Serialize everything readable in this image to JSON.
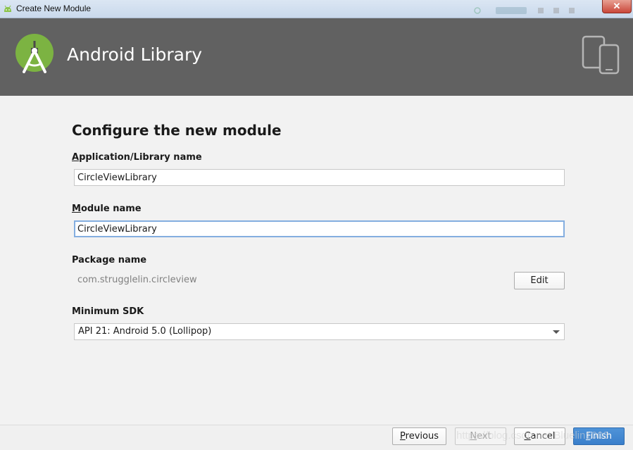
{
  "window": {
    "title": "Create New Module",
    "close_label": "✕"
  },
  "header": {
    "title": "Android Library"
  },
  "form": {
    "page_title": "Configure the new module",
    "app_name_label_mnemonic": "A",
    "app_name_label_rest": "pplication/Library name",
    "app_name_value": "CircleViewLibrary",
    "module_name_label_mnemonic": "M",
    "module_name_label_rest": "odule name",
    "module_name_value": "CircleViewLibrary",
    "package_label": "Package name",
    "package_value": "com.strugglelin.circleview",
    "edit_button": "Edit",
    "min_sdk_label": "Minimum SDK",
    "min_sdk_value": "API 21: Android 5.0 (Lollipop)"
  },
  "footer": {
    "previous_mnemonic": "P",
    "previous_rest": "revious",
    "next_mnemonic": "N",
    "next_rest": "ext",
    "cancel_mnemonic": "C",
    "cancel_rest": "ancel",
    "finish_mnemonic": "F",
    "finish_rest": "inish"
  },
  "watermark": "https://blog.csdn.net/Bluelin1003",
  "colors": {
    "header_bg": "#616161",
    "logo_green": "#7cb342",
    "primary_button": "#3a7fcb"
  },
  "icons": {
    "app_icon": "android-head-icon",
    "logo": "android-studio-logo",
    "device": "phone-tablet-icon"
  }
}
